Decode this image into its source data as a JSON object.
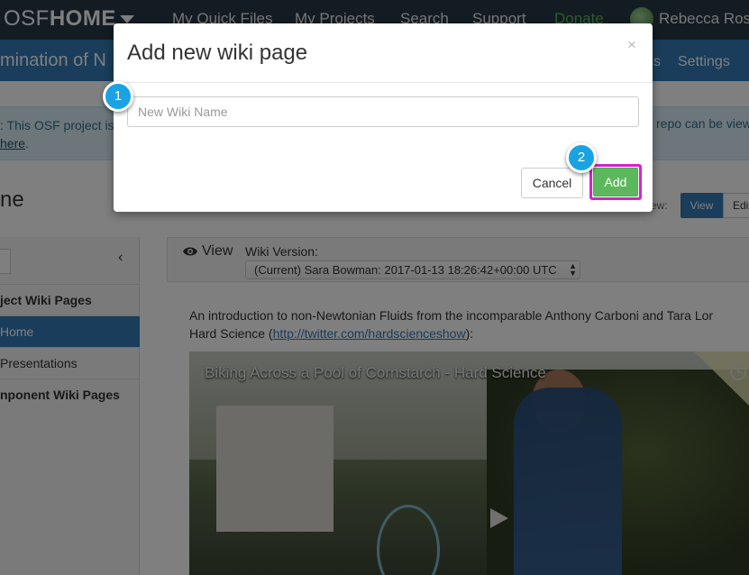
{
  "navbar": {
    "brand_prefix": "OSF",
    "brand_bold": "HOME",
    "links": [
      "My Quick Files",
      "My Projects",
      "Search",
      "Support",
      "Donate"
    ],
    "user_name": "Rebecca Rose"
  },
  "project_nav": {
    "title": "mination of N",
    "items": [
      "s",
      "Settings"
    ]
  },
  "alert": {
    "text": ": This OSF project is",
    "link": "here",
    "after_link": ".",
    "right_text": "repo can be view"
  },
  "page": {
    "heading": "ne",
    "view_mode_label": "ew:",
    "view_button": "View",
    "edit_button": "Edi"
  },
  "sidebar": {
    "section_project": "ject Wiki Pages",
    "items": [
      "Home",
      "Presentations"
    ],
    "section_component": "nponent Wiki Pages"
  },
  "wiki": {
    "view_tab": "View",
    "version_label": "Wiki Version:",
    "version_selected": "(Current) Sara Bowman: 2017-01-13 18:26:42+00:00 UTC",
    "intro_line1": "An introduction to non-Newtonian Fluids from the incomparable Anthony Carboni and Tara Lor",
    "intro_line2_prefix": "Hard Science (",
    "intro_link": "http://twitter.com/hardscienceshow",
    "intro_line2_suffix": "):",
    "video_title": "Biking Across a Pool of Cornstarch - Hard Science"
  },
  "modal": {
    "title": "Add new wiki page",
    "close": "×",
    "input_placeholder": "New Wiki Name",
    "input_value": "",
    "cancel_label": "Cancel",
    "add_label": "Add"
  },
  "callouts": [
    "1",
    "2"
  ],
  "colors": {
    "navbar": "#263947",
    "primary": "#337ab7",
    "success": "#5cb85c",
    "highlight": "#d61fd6",
    "callout": "#1aa3e3"
  }
}
